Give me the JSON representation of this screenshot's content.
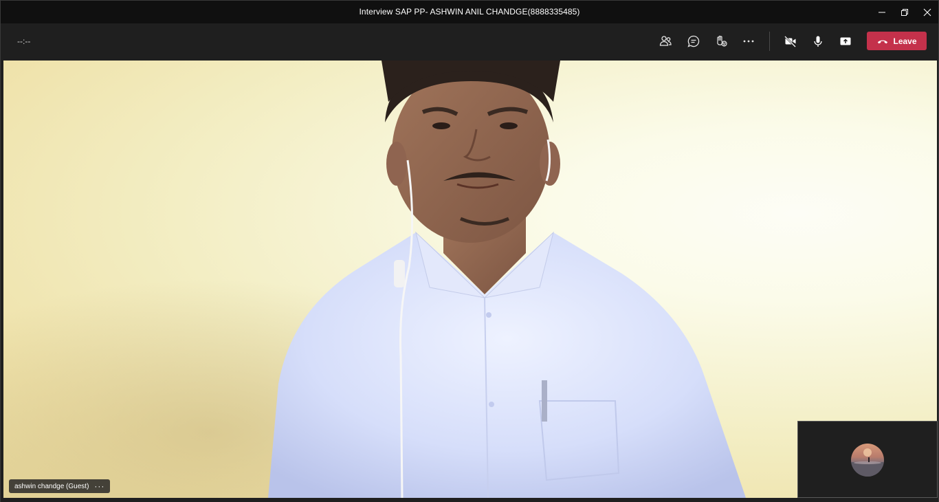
{
  "window": {
    "title": "Interview SAP PP- ASHWIN ANIL CHANDGE(8888335485)",
    "controls": [
      "minimize-icon",
      "restore-icon",
      "close-icon"
    ]
  },
  "toolbar": {
    "timer": "--:--",
    "buttons": [
      {
        "name": "participants",
        "icon": "people-icon"
      },
      {
        "name": "chat",
        "icon": "chat-icon"
      },
      {
        "name": "reactions",
        "icon": "raise-hand-icon"
      },
      {
        "name": "more-actions",
        "icon": "more-icon"
      },
      {
        "name": "camera",
        "icon": "camera-off-icon"
      },
      {
        "name": "mic",
        "icon": "mic-icon"
      },
      {
        "name": "share",
        "icon": "share-screen-icon"
      }
    ],
    "leave_label": "Leave",
    "leave_color": "#c4314b"
  },
  "stage": {
    "participant_name": "ashwin chandge (Guest)",
    "name_more": "···"
  },
  "colors": {
    "titlebar": "#101010",
    "toolbar": "#1f1f1f",
    "accent": "#c4314b"
  }
}
